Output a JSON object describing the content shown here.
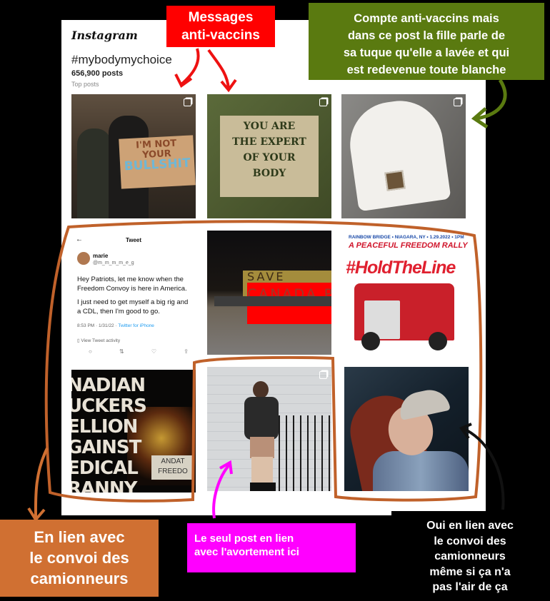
{
  "instagram": {
    "logo": "Instagram",
    "hashtag": "#mybodymychoice",
    "post_count": "656,900 posts",
    "section_label": "Top posts"
  },
  "posts": {
    "p1": {
      "sign_lines": [
        "I'M NOT",
        "YOUR",
        "BULLSHIT"
      ]
    },
    "p2": {
      "lines": [
        "YOU ARE",
        "THE EXPERT",
        "OF YOUR",
        "BODY"
      ]
    },
    "p4": {
      "header": "Tweet",
      "back": "←",
      "name": "marie",
      "handle": "@m_m_m_m_e_g",
      "text1": "Hey Patriots, let me know when the Freedom Convoy is here in America.",
      "text2": "I just need to get myself a big rig and a CDL, then I'm good to go.",
      "time": "8:53 PM · 1/31/22 · ",
      "source": "Twitter for iPhone",
      "activity": "View Tweet activity",
      "icons": [
        "○",
        "⇅",
        "♡",
        "⇪"
      ]
    },
    "p5": {
      "line1": "SAVE",
      "line2": "CANADA PA"
    },
    "p6": {
      "line1": "RAINBOW BRIDGE • NIAGARA, NY • 1.29.2022 • 1PM",
      "line2": "A PEACEFUL FREEDOM RALLY",
      "line3": "#HoldTheLine"
    },
    "p7": {
      "lines": [
        "NADIAN",
        "UCKERS",
        "ELLION",
        "GAINST",
        "EDICAL",
        "RANNY"
      ],
      "sign_lines": [
        "ANDAT",
        "FREEDO"
      ]
    }
  },
  "annotations": {
    "red_lines": [
      "Messages",
      "anti-vaccins"
    ],
    "olive_lines": [
      "Compte anti-vaccins mais",
      "dans ce post la fille parle de",
      "sa tuque qu'elle a lavée et qui",
      "est redevenue toute blanche"
    ],
    "orange_lines": [
      "En lien avec",
      "le convoi des",
      "camionneurs"
    ],
    "magenta_lines": [
      "Le seul post en lien",
      "avec l'avortement ici"
    ],
    "black_lines": [
      "Oui en lien avec",
      "le convoi des",
      "camionneurs",
      "même si ça n'a",
      "pas l'air de ça"
    ]
  },
  "colors": {
    "red": "#ff0000",
    "olive": "#5a7a10",
    "orange": "#d07032",
    "magenta": "#ff00ff",
    "circle": "#b85a24"
  }
}
